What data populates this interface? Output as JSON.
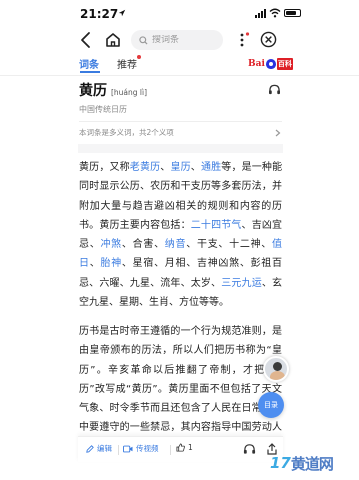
{
  "status_bar": {
    "time": "21:27"
  },
  "nav": {
    "search_placeholder": "搜词条"
  },
  "tabs": {
    "entry": "词条",
    "recommend": "推荐"
  },
  "logo": {
    "brand": "Bai",
    "brand_tag": "百科"
  },
  "entry": {
    "title": "黄历",
    "pinyin": "[huáng lì]",
    "subtitle": "中国传统日历",
    "polysemy": "本词条是多义词，共2个义项"
  },
  "paragraph1": {
    "s1": "黄历，又称",
    "l1": "老黄历",
    "s2": "、",
    "l2": "皇历",
    "s3": "、",
    "l3": "通胜",
    "s4": "等，是一种能同时显示公历、农历和干支历等多套历法，并附加大量与趋吉避凶相关的规则和内容的历书。黄历主要内容包括：",
    "l4": "二十四节气",
    "s5": "、吉凶宜忌、",
    "l5": "冲煞",
    "s6": "、合害、",
    "l6": "纳音",
    "s7": "、干支、十二神、",
    "l7": "值日",
    "s8": "、",
    "l8": "胎神",
    "s9": "、星宿、月相、吉神凶煞、彭祖百忌、六曜、九星、流年、太岁、",
    "l9": "三元九运",
    "s10": "、玄空九星、星期、生肖、方位等等。"
  },
  "paragraph2": {
    "text": "历书是古时帝王遵循的一个行为规范准则，是由皇帝颁布的历法，所以人们把历书称为“皇历”。辛亥革命以后推翻了帝制，才把“皇历”改写成“黄历”。黄历里面不但包括了天文气象、时令季节而且还包含了人民在日常生活中要遵守的一些禁忌，其内容指导中国劳动人民耕种时间，故又称农民历。"
  },
  "floating": {
    "toc_label": "目录"
  },
  "toolbar": {
    "edit_label": "编辑",
    "video_label": "传视频",
    "like_count": "1"
  },
  "watermark": {
    "number": "17",
    "text": "黄道网"
  },
  "colors": {
    "accent": "#3a7be0",
    "toc_button": "#4e8ef0",
    "brand_red": "#de1f26"
  }
}
